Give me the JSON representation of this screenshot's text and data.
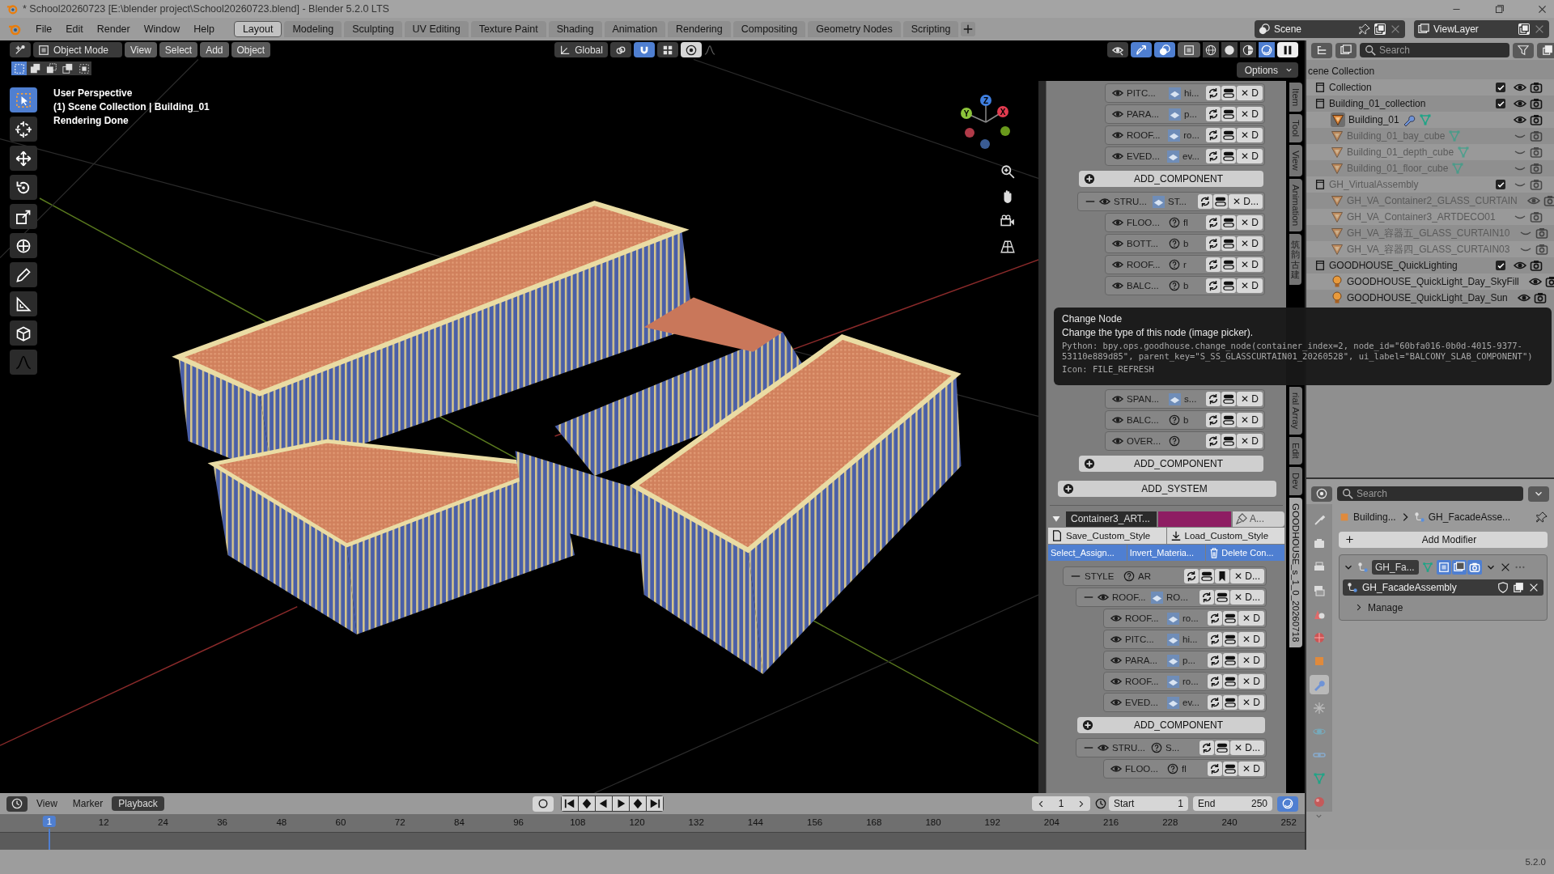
{
  "window": {
    "title": "* School20260723 [E:\\blender project\\School20260723.blend] - Blender 5.2.0 LTS"
  },
  "menu": [
    "File",
    "Edit",
    "Render",
    "Window",
    "Help"
  ],
  "workspaces": [
    {
      "label": "Layout",
      "selected": true
    },
    {
      "label": "Modeling",
      "selected": false
    },
    {
      "label": "Sculpting",
      "selected": false
    },
    {
      "label": "UV Editing",
      "selected": false
    },
    {
      "label": "Texture Paint",
      "selected": false
    },
    {
      "label": "Shading",
      "selected": false
    },
    {
      "label": "Animation",
      "selected": false
    },
    {
      "label": "Rendering",
      "selected": false
    },
    {
      "label": "Compositing",
      "selected": false
    },
    {
      "label": "Geometry Nodes",
      "selected": false
    },
    {
      "label": "Scripting",
      "selected": false
    }
  ],
  "scene": "Scene",
  "view_layer": "ViewLayer",
  "viewport": {
    "mode": "Object Mode",
    "menus": [
      "View",
      "Select",
      "Add",
      "Object"
    ],
    "orientation": "Global",
    "options": "Options",
    "select_modes": [
      {
        "selected": true
      },
      {
        "selected": false
      },
      {
        "selected": false
      },
      {
        "selected": false
      },
      {
        "selected": false
      }
    ],
    "shading": [
      {
        "selected": false
      },
      {
        "selected": false
      },
      {
        "selected": false
      },
      {
        "selected": true
      }
    ],
    "tools": [
      {
        "selected": true
      },
      {
        "selected": false
      },
      {
        "selected": false
      },
      {
        "selected": false
      },
      {
        "selected": false
      },
      {
        "selected": false
      },
      {
        "selected": false
      },
      {
        "selected": false
      },
      {
        "selected": false
      },
      {
        "selected": false
      }
    ],
    "info": [
      "User Perspective",
      "(1) Scene Collection | Building_01",
      "Rendering Done"
    ],
    "axes": [
      "X",
      "Y",
      "Z"
    ]
  },
  "sidebar": {
    "groups": [
      {
        "rows": [
          {
            "kind": "component",
            "name": "PITC...",
            "preview": true,
            "value": "hi...",
            "delete": "✕ D"
          },
          {
            "kind": "component",
            "name": "PARA...",
            "preview": true,
            "value": "p...",
            "delete": "✕ D"
          },
          {
            "kind": "component",
            "name": "ROOF...",
            "preview": true,
            "value": "ro...",
            "delete": "✕ D"
          },
          {
            "kind": "component",
            "name": "EVED...",
            "preview": true,
            "value": "ev...",
            "delete": "✕ D"
          },
          {
            "kind": "add",
            "label": "ADD_COMPONENT"
          },
          {
            "kind": "system",
            "name": "STRU...",
            "preview": true,
            "value": "ST...",
            "delete": "✕ D..."
          },
          {
            "kind": "component",
            "name": "FLOO...",
            "preview": false,
            "value": "fl",
            "delete": "✕ D"
          },
          {
            "kind": "component",
            "name": "BOTT...",
            "preview": false,
            "value": "b",
            "delete": "✕ D"
          },
          {
            "kind": "component",
            "name": "ROOF...",
            "preview": false,
            "value": "r",
            "delete": "✕ D"
          },
          {
            "kind": "component",
            "name": "BALC...",
            "preview": false,
            "value": "b",
            "delete": "✕ D"
          }
        ]
      },
      {
        "rows": [
          {
            "kind": "component",
            "name": "SPAN...",
            "preview": true,
            "value": "s...",
            "delete": "✕ D"
          },
          {
            "kind": "component",
            "name": "BALC...",
            "preview": false,
            "value": "b",
            "delete": "✕ D"
          },
          {
            "kind": "component",
            "name": "OVER...",
            "preview": false,
            "delete": "✕ D"
          },
          {
            "kind": "add",
            "label": "ADD_COMPONENT"
          },
          {
            "kind": "add_system",
            "label": "ADD_SYSTEM"
          }
        ]
      }
    ],
    "container": {
      "expanded": true,
      "name": "Container3_ART...",
      "color": "#8e1d63",
      "button": "A...",
      "style_buttons": [
        "Save_Custom_Style",
        "Load_Custom_Style"
      ],
      "actions": [
        "Select_Assign...",
        "Invert_Materia...",
        "Delete Con..."
      ],
      "rows": [
        {
          "kind": "style",
          "name": "STYLE",
          "preview": false,
          "value": "AR",
          "delete": "✕ D..."
        },
        {
          "kind": "system",
          "name": "ROOF...",
          "preview": true,
          "value": "RO...",
          "delete": "✕ D..."
        },
        {
          "kind": "component",
          "name": "ROOF...",
          "preview": true,
          "value": "ro...",
          "delete": "✕ D"
        },
        {
          "kind": "component",
          "name": "PITC...",
          "preview": true,
          "value": "hi...",
          "delete": "✕ D"
        },
        {
          "kind": "component",
          "name": "PARA...",
          "preview": true,
          "value": "p...",
          "delete": "✕ D"
        },
        {
          "kind": "component",
          "name": "ROOF...",
          "preview": true,
          "value": "ro...",
          "delete": "✕ D"
        },
        {
          "kind": "component",
          "name": "EVED...",
          "preview": true,
          "value": "ev...",
          "delete": "✕ D"
        },
        {
          "kind": "add",
          "label": "ADD_COMPONENT"
        },
        {
          "kind": "system",
          "name": "STRU...",
          "preview": false,
          "value": "S...",
          "delete": "✕ D..."
        },
        {
          "kind": "component",
          "name": "FLOO...",
          "preview": false,
          "value": "fl",
          "delete": "✕ D"
        }
      ]
    },
    "tabs_top": [
      {
        "label": "Item",
        "kind": "rotated",
        "selected": false
      },
      {
        "label": "Tool",
        "kind": "rotated",
        "selected": false
      },
      {
        "label": "View",
        "kind": "rotated",
        "selected": false
      },
      {
        "label": "Animation",
        "kind": "rotated",
        "selected": false
      },
      {
        "label": "筑韵古建",
        "kind": "stacked",
        "selected": false
      }
    ],
    "tabs_bottom": [
      {
        "label": "rial Array",
        "kind": "rotated",
        "selected": false
      },
      {
        "label": "Edit",
        "kind": "rotated",
        "selected": false
      },
      {
        "label": "Dev",
        "kind": "rotated",
        "selected": false
      },
      {
        "label": "GOODHOUSE_s_1_0_20260718",
        "kind": "rotated",
        "selected": true
      }
    ]
  },
  "tooltip": {
    "title": "Change Node",
    "description": "Change the type of this node (image picker).",
    "python": "Python: bpy.ops.goodhouse.change_node(container_index=2, node_id=\"60bfa016-0b0d-4015-9377-53110e889d85\", parent_key=\"S_SS_GLASSCURTAIN01_20260528\", ui_label=\"BALCONY_SLAB_COMPONENT\")",
    "icon": "Icon: FILE_REFRESH"
  },
  "outliner": {
    "placeholder": "Search",
    "root": "cene Collection",
    "items": [
      {
        "name": "Collection",
        "kind": "collection",
        "checked": true,
        "visible": true,
        "enabled": true
      },
      {
        "name": "Building_01_collection",
        "kind": "collection",
        "checked": true,
        "visible": true,
        "enabled": true,
        "children": [
          {
            "name": "Building_01",
            "kind": "object",
            "visible": true,
            "enabled": true,
            "active": true,
            "modifier": true,
            "mesh_data": true
          },
          {
            "name": "Building_01_bay_cube",
            "kind": "object",
            "visible": false,
            "enabled": false,
            "active": false,
            "modifier": false,
            "mesh_data": true
          },
          {
            "name": "Building_01_depth_cube",
            "kind": "object",
            "visible": false,
            "enabled": false,
            "active": false,
            "modifier": false,
            "mesh_data": true
          },
          {
            "name": "Building_01_floor_cube",
            "kind": "object",
            "visible": false,
            "enabled": false,
            "active": false,
            "modifier": false,
            "mesh_data": true
          }
        ]
      },
      {
        "name": "GH_VirtualAssembly",
        "kind": "collection",
        "checked": true,
        "visible": false,
        "enabled": false,
        "children": [
          {
            "name": "GH_VA_Container2_GLASS_CURTAIN",
            "kind": "object",
            "visible": true,
            "enabled": false,
            "active": false,
            "modifier": false,
            "mesh_data": false
          },
          {
            "name": "GH_VA_Container3_ARTDECO01",
            "kind": "object",
            "visible": false,
            "enabled": false,
            "active": false,
            "modifier": false,
            "mesh_data": false
          },
          {
            "name": "GH_VA_容器五_GLASS_CURTAIN10",
            "kind": "object",
            "visible": false,
            "enabled": false,
            "active": false,
            "modifier": false,
            "mesh_data": false
          },
          {
            "name": "GH_VA_容器四_GLASS_CURTAIN03",
            "kind": "object",
            "visible": false,
            "enabled": false,
            "active": false,
            "modifier": false,
            "mesh_data": false
          }
        ]
      },
      {
        "name": "GOODHOUSE_QuickLighting",
        "kind": "collection",
        "checked": true,
        "visible": true,
        "enabled": true,
        "children": [
          {
            "name": "GOODHOUSE_QuickLight_Day_SkyFill",
            "kind": "light",
            "visible": true,
            "enabled": true,
            "active": false,
            "modifier": false,
            "mesh_data": false
          },
          {
            "name": "GOODHOUSE_QuickLight_Day_Sun",
            "kind": "light",
            "visible": true,
            "enabled": true,
            "active": false,
            "modifier": false,
            "mesh_data": false
          }
        ]
      }
    ]
  },
  "properties": {
    "placeholder": "Search",
    "tabs": [
      {
        "selected": false
      },
      {
        "selected": false
      },
      {
        "selected": false
      },
      {
        "selected": false
      },
      {
        "selected": false
      },
      {
        "selected": false
      },
      {
        "selected": false
      },
      {
        "selected": true
      },
      {
        "selected": false
      },
      {
        "selected": false
      },
      {
        "selected": false
      },
      {
        "selected": false
      },
      {
        "selected": false
      }
    ],
    "breadcrumb": [
      "Building...",
      "GH_FacadeAsse..."
    ],
    "add_modifier": "Add Modifier",
    "modifier": {
      "name": "GH_Fa...",
      "node_group": "GH_FacadeAssembly",
      "expanded": true
    },
    "subpanel": {
      "label": "Manage",
      "expanded": false
    }
  },
  "timeline": {
    "menus": [
      "View",
      "Marker",
      "Playback"
    ],
    "frame": "1",
    "start_label": "Start",
    "start": "1",
    "end_label": "End",
    "end": "250",
    "ticks": [
      {
        "label": "1",
        "selected": true
      },
      {
        "label": "12",
        "selected": false
      },
      {
        "label": "24",
        "selected": false
      },
      {
        "label": "36",
        "selected": false
      },
      {
        "label": "48",
        "selected": false
      },
      {
        "label": "60",
        "selected": false
      },
      {
        "label": "72",
        "selected": false
      },
      {
        "label": "84",
        "selected": false
      },
      {
        "label": "96",
        "selected": false
      },
      {
        "label": "108",
        "selected": false
      },
      {
        "label": "120",
        "selected": false
      },
      {
        "label": "132",
        "selected": false
      },
      {
        "label": "144",
        "selected": false
      },
      {
        "label": "156",
        "selected": false
      },
      {
        "label": "168",
        "selected": false
      },
      {
        "label": "180",
        "selected": false
      },
      {
        "label": "192",
        "selected": false
      },
      {
        "label": "204",
        "selected": false
      },
      {
        "label": "216",
        "selected": false
      },
      {
        "label": "228",
        "selected": false
      },
      {
        "label": "240",
        "selected": false
      },
      {
        "label": "252",
        "selected": false
      }
    ]
  },
  "status_bar": {
    "version": "5.2.0"
  }
}
